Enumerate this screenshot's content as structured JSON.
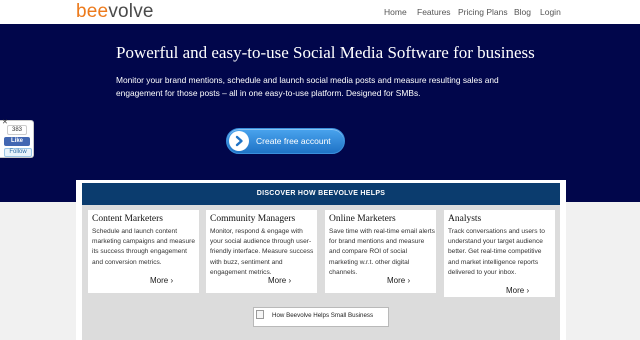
{
  "header": {
    "logo_part1": "bee",
    "logo_part2": "volve",
    "nav": [
      "Home",
      "Features",
      "Pricing Plans",
      "Blog",
      "Login"
    ]
  },
  "hero": {
    "title": "Powerful and easy-to-use Social Media Software for business",
    "description": "Monitor your brand mentions, schedule and launch social media posts and measure resulting sales and engagement for those posts – all in one easy-to-use platform. Designed for SMBs.",
    "cta_label": "Create free account"
  },
  "social": {
    "close": "✕",
    "like_count": "383",
    "like_label": "Like",
    "follow_label": "Follow"
  },
  "helps": {
    "heading": "DISCOVER HOW BEEVOLVE HELPS",
    "cards": [
      {
        "title": "Content Marketers",
        "text": "Schedule and launch content marketing campaigns and measure its success through engagement and conversion metrics.",
        "more": "More ›"
      },
      {
        "title": "Community Managers",
        "text": "Monitor, respond & engage with your social audience through user-friendly interface. Measure success with buzz, sentiment and engagement metrics.",
        "more": "More ›"
      },
      {
        "title": "Online Marketers",
        "text": "Save time with real-time email alerts for brand mentions and measure and compare ROI of social marketing w.r.t. other digital channels.",
        "more": "More ›"
      },
      {
        "title": "Analysts",
        "text": "Track conversations and users to understand your target audience better. Get real-time competitive and market intelligence reports delivered to your inbox.",
        "more": "More ›"
      }
    ],
    "image_alt": "How Beevolve Helps Small Business"
  },
  "colors": {
    "hero_bg": "#01064b",
    "logo_orange": "#ec7a1c",
    "panel_header": "#0b3c6e",
    "cta_blue": "#2f86d8"
  },
  "icons": [
    "chevron-right-icon",
    "broken-image-icon",
    "close-icon"
  ]
}
